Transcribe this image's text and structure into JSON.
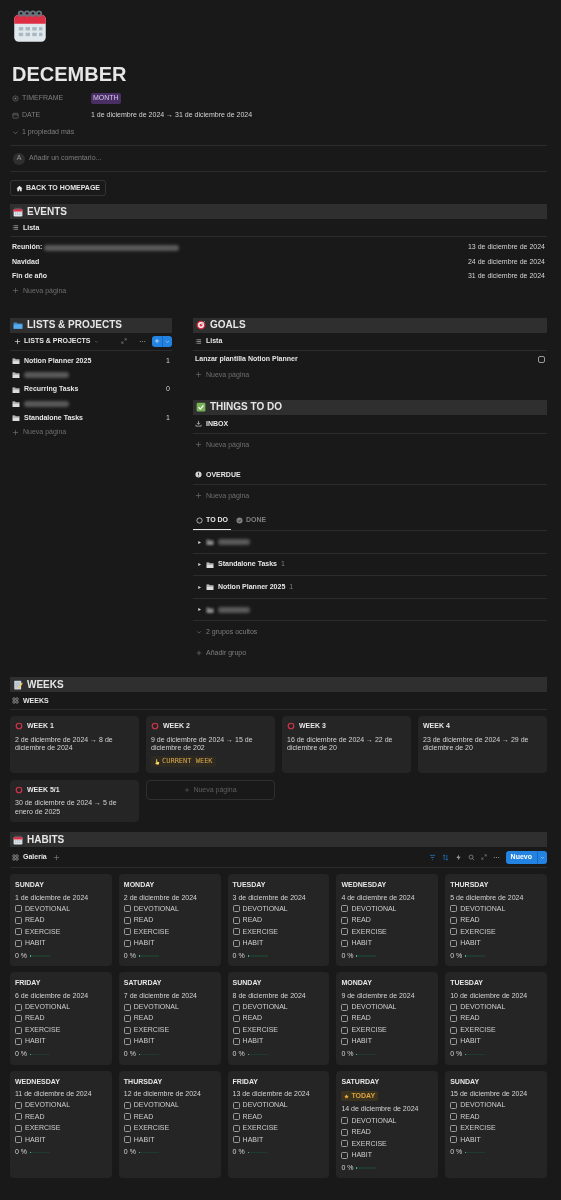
{
  "page": {
    "title": "DECEMBER"
  },
  "properties": [
    {
      "kind": "select",
      "label": "TIMEFRAME",
      "value": "MONTH"
    },
    {
      "kind": "date",
      "label": "DATE",
      "value": "1 de diciembre de 2024 → 31 de diciembre de 2024"
    }
  ],
  "more_properties": "1 propiedad más",
  "comment": {
    "avatar": "A",
    "placeholder": "Añadir un comentario..."
  },
  "home_button": "BACK TO HOMEPAGE",
  "events": {
    "title": "EVENTS",
    "view": "Lista",
    "rows": [
      {
        "name": "Reunión:",
        "blurred": true,
        "date": "13 de diciembre de 2024"
      },
      {
        "name": "Navidad",
        "blurred": false,
        "date": "24 de diciembre de 2024"
      },
      {
        "name": "Fin de año",
        "blurred": false,
        "date": "31 de diciembre de 2024"
      }
    ],
    "new": "Nueva página"
  },
  "lists": {
    "title": "LISTS & PROJECTS",
    "view": "LISTS & PROJECTS",
    "items": [
      {
        "name": "Notion Planner 2025",
        "count": "1",
        "blurred": false
      },
      {
        "blurred": true
      },
      {
        "name": "Recurring Tasks",
        "count": "0",
        "blurred": false
      },
      {
        "blurred": true
      },
      {
        "name": "Standalone Tasks",
        "count": "1",
        "blurred": false
      }
    ],
    "new": "Nueva página"
  },
  "goals": {
    "title": "GOALS",
    "view": "Lista",
    "rows": [
      {
        "name": "Lanzar plantilla Notion Planner",
        "checked": false
      }
    ],
    "new": "Nueva página"
  },
  "things": {
    "title": "THINGS TO DO",
    "groups": [
      {
        "kind": "inbox",
        "label": "INBOX",
        "new": "Nueva página"
      },
      {
        "kind": "overdue",
        "label": "OVERDUE",
        "new": "Nueva página"
      }
    ],
    "tabs": [
      {
        "kind": "todo",
        "label": "TO DO",
        "selected": true
      },
      {
        "kind": "done",
        "label": "DONE",
        "selected": false
      }
    ],
    "board_groups": [
      {
        "blurred": true
      },
      {
        "name": "Standalone Tasks",
        "count": "1",
        "blurred": false
      },
      {
        "name": "Notion Planner 2025",
        "count": "1",
        "blurred": false
      },
      {
        "blurred": true
      }
    ],
    "hidden_groups": "2 grupos ocultos",
    "add_group": "Añadir grupo"
  },
  "weeks": {
    "title": "WEEKS",
    "view": "WEEKS",
    "cards": [
      {
        "name": "WEEK 1",
        "flagged": true,
        "dates": "2 de diciembre de 2024 → 8 de diciembre de 2024"
      },
      {
        "name": "WEEK 2",
        "flagged": true,
        "dates": "9 de diciembre de 2024 → 15 de diciembre de 202",
        "badge": "CURRENT WEEK"
      },
      {
        "name": "WEEK 3",
        "flagged": true,
        "dates": "16 de diciembre de 2024 → 22 de diciembre de 20"
      },
      {
        "name": "WEEK 4",
        "flagged": false,
        "dates": "23 de diciembre de 2024 → 29 de diciembre de 20"
      },
      {
        "name": "WEEK 5/1",
        "flagged": true,
        "dates": "30 de diciembre de 2024 → 5 de enero de 2025"
      }
    ],
    "new": "Nueva página"
  },
  "habits": {
    "title": "HABITS",
    "view": "Galería",
    "new_button": "Nuevo",
    "cards": [
      {
        "day": "SUNDAY",
        "date": "1 de diciembre de 2024",
        "habits": [
          {
            "label": "DEVOTIONAL",
            "checked": false
          },
          {
            "label": "READ",
            "checked": false
          },
          {
            "label": "EXERCISE",
            "checked": false
          },
          {
            "label": "HABIT",
            "checked": false
          }
        ],
        "progress": "0 %",
        "level": 0
      },
      {
        "day": "MONDAY",
        "date": "2 de diciembre de 2024",
        "habits": [
          {
            "label": "DEVOTIONAL",
            "checked": false
          },
          {
            "label": "READ",
            "checked": false
          },
          {
            "label": "EXERCISE",
            "checked": false
          },
          {
            "label": "HABIT",
            "checked": false
          }
        ],
        "progress": "0 %",
        "level": 0
      },
      {
        "day": "TUESDAY",
        "date": "3 de diciembre de 2024",
        "habits": [
          {
            "label": "DEVOTIONAL",
            "checked": false
          },
          {
            "label": "READ",
            "checked": false
          },
          {
            "label": "EXERCISE",
            "checked": false
          },
          {
            "label": "HABIT",
            "checked": false
          }
        ],
        "progress": "0 %",
        "level": 0
      },
      {
        "day": "WEDNESDAY",
        "date": "4 de diciembre de 2024",
        "habits": [
          {
            "label": "DEVOTIONAL",
            "checked": false
          },
          {
            "label": "READ",
            "checked": false
          },
          {
            "label": "EXERCISE",
            "checked": false
          },
          {
            "label": "HABIT",
            "checked": false
          }
        ],
        "progress": "0 %",
        "level": 0
      },
      {
        "day": "THURSDAY",
        "date": "5 de diciembre de 2024",
        "habits": [
          {
            "label": "DEVOTIONAL",
            "checked": false
          },
          {
            "label": "READ",
            "checked": false
          },
          {
            "label": "EXERCISE",
            "checked": false
          },
          {
            "label": "HABIT",
            "checked": false
          }
        ],
        "progress": "0 %",
        "level": 0
      },
      {
        "day": "FRIDAY",
        "date": "6 de diciembre de 2024",
        "habits": [
          {
            "label": "DEVOTIONAL",
            "checked": false
          },
          {
            "label": "READ",
            "checked": false
          },
          {
            "label": "EXERCISE",
            "checked": false
          },
          {
            "label": "HABIT",
            "checked": false
          }
        ],
        "progress": "0 %",
        "level": 0
      },
      {
        "day": "SATURDAY",
        "date": "7 de diciembre de 2024",
        "habits": [
          {
            "label": "DEVOTIONAL",
            "checked": false
          },
          {
            "label": "READ",
            "checked": false
          },
          {
            "label": "EXERCISE",
            "checked": false
          },
          {
            "label": "HABIT",
            "checked": false
          }
        ],
        "progress": "0 %",
        "level": 0
      },
      {
        "day": "SUNDAY",
        "date": "8 de diciembre de 2024",
        "habits": [
          {
            "label": "DEVOTIONAL",
            "checked": false
          },
          {
            "label": "READ",
            "checked": false
          },
          {
            "label": "EXERCISE",
            "checked": false
          },
          {
            "label": "HABIT",
            "checked": false
          }
        ],
        "progress": "0 %",
        "level": 0
      },
      {
        "day": "MONDAY",
        "date": "9 de diciembre de 2024",
        "habits": [
          {
            "label": "DEVOTIONAL",
            "checked": false
          },
          {
            "label": "READ",
            "checked": false
          },
          {
            "label": "EXERCISE",
            "checked": false
          },
          {
            "label": "HABIT",
            "checked": false
          }
        ],
        "progress": "0 %",
        "level": 0
      },
      {
        "day": "TUESDAY",
        "date": "10 de diciembre de 2024",
        "habits": [
          {
            "label": "DEVOTIONAL",
            "checked": false
          },
          {
            "label": "READ",
            "checked": false
          },
          {
            "label": "EXERCISE",
            "checked": false
          },
          {
            "label": "HABIT",
            "checked": false
          }
        ],
        "progress": "0 %",
        "level": 0
      },
      {
        "day": "WEDNESDAY",
        "date": "11 de diciembre de 2024",
        "habits": [
          {
            "label": "DEVOTIONAL",
            "checked": false
          },
          {
            "label": "READ",
            "checked": false
          },
          {
            "label": "EXERCISE",
            "checked": false
          },
          {
            "label": "HABIT",
            "checked": false
          }
        ],
        "progress": "0 %",
        "level": 0
      },
      {
        "day": "THURSDAY",
        "date": "12 de diciembre de 2024",
        "habits": [
          {
            "label": "DEVOTIONAL",
            "checked": false
          },
          {
            "label": "READ",
            "checked": false
          },
          {
            "label": "EXERCISE",
            "checked": false
          },
          {
            "label": "HABIT",
            "checked": false
          }
        ],
        "progress": "0 %",
        "level": 0
      },
      {
        "day": "FRIDAY",
        "date": "13 de diciembre de 2024",
        "habits": [
          {
            "label": "DEVOTIONAL",
            "checked": false
          },
          {
            "label": "READ",
            "checked": false
          },
          {
            "label": "EXERCISE",
            "checked": false
          },
          {
            "label": "HABIT",
            "checked": false
          }
        ],
        "progress": "0 %",
        "level": 0
      },
      {
        "day": "SATURDAY",
        "badge": "TODAY",
        "date": "14 de diciembre de 2024",
        "habits": [
          {
            "label": "DEVOTIONAL",
            "checked": false
          },
          {
            "label": "READ",
            "checked": false
          },
          {
            "label": "EXERCISE",
            "checked": false
          },
          {
            "label": "HABIT",
            "checked": false
          }
        ],
        "progress": "0 %",
        "level": 0
      },
      {
        "day": "SUNDAY",
        "date": "15 de diciembre de 2024",
        "habits": [
          {
            "label": "DEVOTIONAL",
            "checked": false
          },
          {
            "label": "READ",
            "checked": false
          },
          {
            "label": "EXERCISE",
            "checked": false
          },
          {
            "label": "HABIT",
            "checked": false
          }
        ],
        "progress": "0 %",
        "level": 0
      }
    ]
  }
}
